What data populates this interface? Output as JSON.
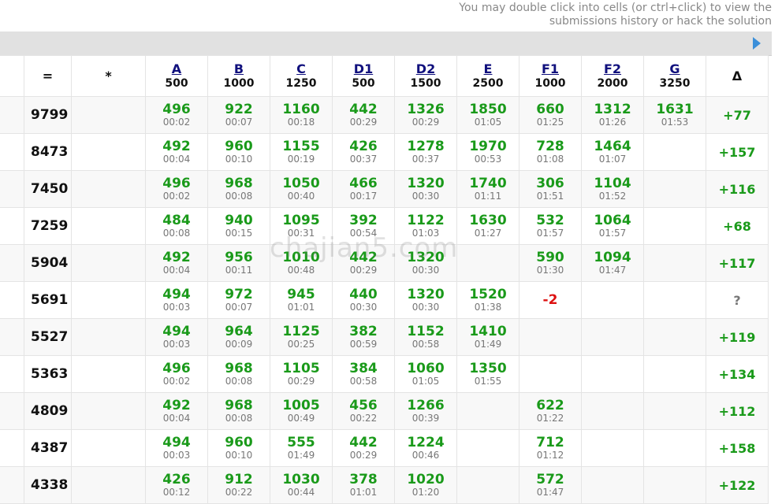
{
  "hint": {
    "line1": "You may double click into cells (or ctrl+click) to view the",
    "line2": "submissions history or hack the solution"
  },
  "header": {
    "points_symbol": "=",
    "star_symbol": "*",
    "delta_symbol": "Δ",
    "problems": [
      {
        "name": "A",
        "points": "500"
      },
      {
        "name": "B",
        "points": "1000"
      },
      {
        "name": "C",
        "points": "1250"
      },
      {
        "name": "D1",
        "points": "500"
      },
      {
        "name": "D2",
        "points": "1500"
      },
      {
        "name": "E",
        "points": "2500"
      },
      {
        "name": "F1",
        "points": "1000"
      },
      {
        "name": "F2",
        "points": "2000"
      },
      {
        "name": "G",
        "points": "3250"
      }
    ]
  },
  "rows": [
    {
      "points": "9799",
      "cells": [
        [
          "496",
          "00:02"
        ],
        [
          "922",
          "00:07"
        ],
        [
          "1160",
          "00:18"
        ],
        [
          "442",
          "00:29"
        ],
        [
          "1326",
          "00:29"
        ],
        [
          "1850",
          "01:05"
        ],
        [
          "660",
          "01:25"
        ],
        [
          "1312",
          "01:26"
        ],
        [
          "1631",
          "01:53"
        ]
      ],
      "delta": "+77"
    },
    {
      "points": "8473",
      "cells": [
        [
          "492",
          "00:04"
        ],
        [
          "960",
          "00:10"
        ],
        [
          "1155",
          "00:19"
        ],
        [
          "426",
          "00:37"
        ],
        [
          "1278",
          "00:37"
        ],
        [
          "1970",
          "00:53"
        ],
        [
          "728",
          "01:08"
        ],
        [
          "1464",
          "01:07"
        ],
        [
          "",
          ""
        ]
      ],
      "delta": "+157"
    },
    {
      "points": "7450",
      "cells": [
        [
          "496",
          "00:02"
        ],
        [
          "968",
          "00:08"
        ],
        [
          "1050",
          "00:40"
        ],
        [
          "466",
          "00:17"
        ],
        [
          "1320",
          "00:30"
        ],
        [
          "1740",
          "01:11"
        ],
        [
          "306",
          "01:51"
        ],
        [
          "1104",
          "01:52"
        ],
        [
          "",
          ""
        ]
      ],
      "delta": "+116"
    },
    {
      "points": "7259",
      "cells": [
        [
          "484",
          "00:08"
        ],
        [
          "940",
          "00:15"
        ],
        [
          "1095",
          "00:31"
        ],
        [
          "392",
          "00:54"
        ],
        [
          "1122",
          "01:03"
        ],
        [
          "1630",
          "01:27"
        ],
        [
          "532",
          "01:57"
        ],
        [
          "1064",
          "01:57"
        ],
        [
          "",
          ""
        ]
      ],
      "delta": "+68"
    },
    {
      "points": "5904",
      "cells": [
        [
          "492",
          "00:04"
        ],
        [
          "956",
          "00:11"
        ],
        [
          "1010",
          "00:48"
        ],
        [
          "442",
          "00:29"
        ],
        [
          "1320",
          "00:30"
        ],
        [
          "",
          ""
        ],
        [
          "590",
          "01:30"
        ],
        [
          "1094",
          "01:47"
        ],
        [
          "",
          ""
        ]
      ],
      "delta": "+117"
    },
    {
      "points": "5691",
      "cells": [
        [
          "494",
          "00:03"
        ],
        [
          "972",
          "00:07"
        ],
        [
          "945",
          "01:01"
        ],
        [
          "440",
          "00:30"
        ],
        [
          "1320",
          "00:30"
        ],
        [
          "1520",
          "01:38"
        ],
        [
          "-2",
          ""
        ],
        [
          "",
          ""
        ],
        [
          "",
          ""
        ]
      ],
      "delta": "?"
    },
    {
      "points": "5527",
      "cells": [
        [
          "494",
          "00:03"
        ],
        [
          "964",
          "00:09"
        ],
        [
          "1125",
          "00:25"
        ],
        [
          "382",
          "00:59"
        ],
        [
          "1152",
          "00:58"
        ],
        [
          "1410",
          "01:49"
        ],
        [
          "",
          ""
        ],
        [
          "",
          ""
        ],
        [
          "",
          ""
        ]
      ],
      "delta": "+119"
    },
    {
      "points": "5363",
      "cells": [
        [
          "496",
          "00:02"
        ],
        [
          "968",
          "00:08"
        ],
        [
          "1105",
          "00:29"
        ],
        [
          "384",
          "00:58"
        ],
        [
          "1060",
          "01:05"
        ],
        [
          "1350",
          "01:55"
        ],
        [
          "",
          ""
        ],
        [
          "",
          ""
        ],
        [
          "",
          ""
        ]
      ],
      "delta": "+134"
    },
    {
      "points": "4809",
      "cells": [
        [
          "492",
          "00:04"
        ],
        [
          "968",
          "00:08"
        ],
        [
          "1005",
          "00:49"
        ],
        [
          "456",
          "00:22"
        ],
        [
          "1266",
          "00:39"
        ],
        [
          "",
          ""
        ],
        [
          "622",
          "01:22"
        ],
        [
          "",
          ""
        ],
        [
          "",
          ""
        ]
      ],
      "delta": "+112"
    },
    {
      "points": "4387",
      "cells": [
        [
          "494",
          "00:03"
        ],
        [
          "960",
          "00:10"
        ],
        [
          "555",
          "01:49"
        ],
        [
          "442",
          "00:29"
        ],
        [
          "1224",
          "00:46"
        ],
        [
          "",
          ""
        ],
        [
          "712",
          "01:12"
        ],
        [
          "",
          ""
        ],
        [
          "",
          ""
        ]
      ],
      "delta": "+158"
    },
    {
      "points": "4338",
      "cells": [
        [
          "426",
          "00:12"
        ],
        [
          "912",
          "00:22"
        ],
        [
          "1030",
          "00:44"
        ],
        [
          "378",
          "01:01"
        ],
        [
          "1020",
          "01:20"
        ],
        [
          "",
          ""
        ],
        [
          "572",
          "01:47"
        ],
        [
          "",
          ""
        ],
        [
          "",
          ""
        ]
      ],
      "delta": "+122"
    }
  ],
  "watermark": "chajian5.com"
}
